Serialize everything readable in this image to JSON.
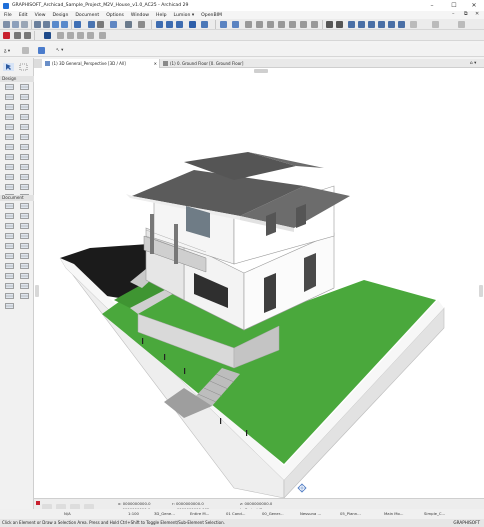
{
  "window": {
    "title": "GRAPHISOFT_Archicad_Sample_Project_M2V_House_v1.0_AC25 - Archicad 29",
    "controls": {
      "minimize": "–",
      "maximize": "☐",
      "close": "✕"
    }
  },
  "menu": {
    "items": [
      "File",
      "Edit",
      "View",
      "Design",
      "Document",
      "Options",
      "Window",
      "Help",
      "Lumion ▾",
      "OpenBIM"
    ],
    "window_controls": {
      "minimize": "–",
      "restore": "⧉",
      "close": "✕"
    }
  },
  "toolbar3": {
    "story": "ᵹ ▾",
    "pointer": "↖ ▾"
  },
  "toolbox": {
    "design_header": "Design",
    "document_header": "Document",
    "design_tools": [
      "wall",
      "column",
      "beam",
      "slab",
      "roof",
      "shell",
      "mesh",
      "zone",
      "door",
      "window",
      "skylight",
      "curtain-wall",
      "stair",
      "railing",
      "object",
      "lamp",
      "morph",
      "opening",
      "beam-column",
      "profile",
      "cw-frame",
      "cw-panel",
      "end-wall",
      "stair-tread"
    ],
    "document_tools": [
      "dimension",
      "level-dim",
      "text",
      "label",
      "fill",
      "line",
      "arc",
      "polyline",
      "spline",
      "hotspot",
      "section",
      "elevation",
      "interior-elev",
      "worksheet",
      "detail",
      "change",
      "drawing",
      "figure",
      "grid",
      "radial-dim",
      "angle-dim"
    ]
  },
  "tabs": [
    {
      "label": "(1) 3D General_Perspective [3D / All]",
      "close": "✕"
    },
    {
      "label": "(1) 0. Ground Floor [0. Ground Floor]"
    }
  ],
  "tabs_menu": "⌂ ▾",
  "coords": {
    "x": "x: 0000000000.0",
    "y": "y: 0000000000.0",
    "r": "r: 0000000000.0",
    "a": "a: 0000000000.00°",
    "z": "z: 0000000000.0",
    "z_ref": "to Project Zero"
  },
  "bottombar": {
    "zoom": "N/A",
    "scale": "1:100",
    "layer": "3D_Gene...",
    "model": "Entire M...",
    "pen": "01 Cond...",
    "struct": "00_Gener...",
    "reno": "Nessuna ...",
    "mvo": "05_Plann...",
    "layers_main": "Main Mo...",
    "view": "Simple_C..."
  },
  "hint": {
    "text": "Click an Element or Draw a Selection Area. Press and Hold Ctrl+Shift to Toggle Element/Sub-Element Selection.",
    "brand": "GRAPHISOFT"
  },
  "colors": {
    "accent": "#1e6fd9",
    "grass": "#4aa83c",
    "roof": "#5b5b5b",
    "wall": "#f4f4f4",
    "driveway": "#1e1e1e"
  }
}
